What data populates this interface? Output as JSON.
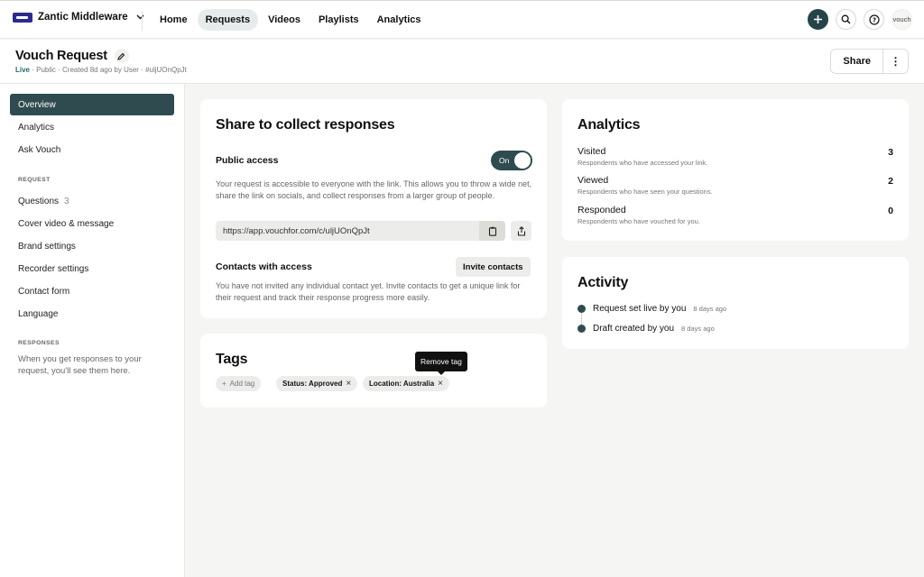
{
  "topbar": {
    "org_name": "Zantic Middleware",
    "nav": [
      "Home",
      "Requests",
      "Videos",
      "Playlists",
      "Analytics"
    ],
    "active_nav": "Requests",
    "user_label": "vouch"
  },
  "page": {
    "title": "Vouch Request",
    "status": "Live",
    "meta": " · Public · Created 8d ago by User · #uljUOnQpJt",
    "share_label": "Share",
    "more_label": "⋮"
  },
  "sidebar": {
    "items": [
      {
        "label": "Overview",
        "active": true
      },
      {
        "label": "Analytics"
      },
      {
        "label": "Ask Vouch"
      }
    ],
    "request_heading": "REQUEST",
    "request_items": [
      {
        "label": "Questions",
        "count": "3"
      },
      {
        "label": "Cover video & message"
      },
      {
        "label": "Brand settings"
      },
      {
        "label": "Recorder settings"
      },
      {
        "label": "Contact form"
      },
      {
        "label": "Language"
      }
    ],
    "responses_heading": "RESPONSES",
    "responses_note": "When you get responses to your request, you'll see them here."
  },
  "share": {
    "title": "Share to collect responses",
    "public_access_label": "Public access",
    "toggle_label": "On",
    "public_desc": "Your request is accessible to everyone with the link. This allows you to throw a wide net, share the link on socials, and collect responses from a larger group of people.",
    "link": "https://app.vouchfor.com/c/uljUOnQpJt",
    "contacts_label": "Contacts with access",
    "invite_label": "Invite contacts",
    "contacts_desc": "You have not invited any individual contact yet. Invite contacts to get a unique link for their request and track their response progress more easily."
  },
  "tags": {
    "title": "Tags",
    "add_label": "Add tag",
    "items": [
      "Status: Approved",
      "Location: Australia"
    ],
    "tooltip": "Remove tag"
  },
  "analytics": {
    "title": "Analytics",
    "stats": [
      {
        "name": "Visited",
        "sub": "Respondents who have accessed your link.",
        "value": "3"
      },
      {
        "name": "Viewed",
        "sub": "Respondents who have seen your questions.",
        "value": "2"
      },
      {
        "name": "Responded",
        "sub": "Respondents who have vouched for you.",
        "value": "0"
      }
    ]
  },
  "activity": {
    "title": "Activity",
    "items": [
      {
        "text": "Request set live by you",
        "time": "8 days ago"
      },
      {
        "text": "Draft created by you",
        "time": "8 days ago"
      }
    ]
  },
  "colors": {
    "accent": "#2f4b50",
    "live": "#1f6f6a"
  }
}
